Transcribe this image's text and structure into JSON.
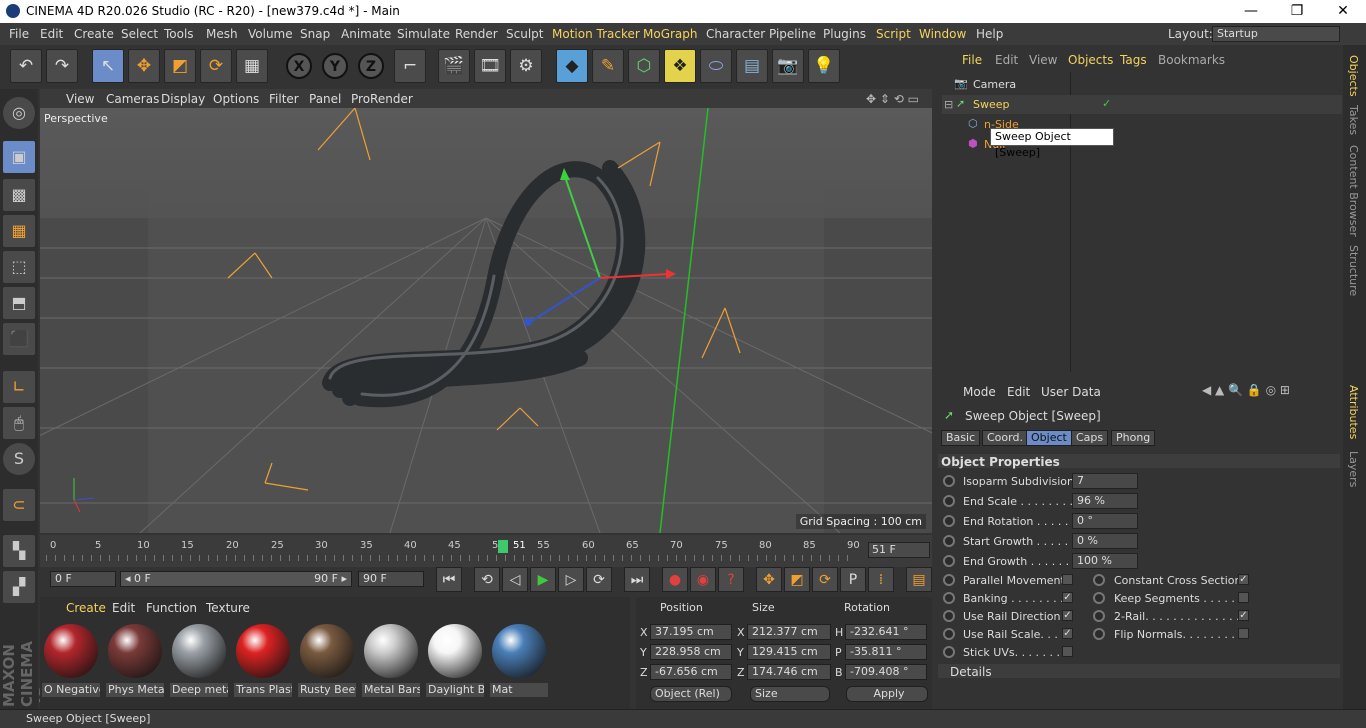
{
  "window": {
    "title": "CINEMA 4D R20.026 Studio (RC - R20) - [new379.c4d *] - Main",
    "minimize": "—",
    "maximize": "❐",
    "close": "✕"
  },
  "menu": {
    "items": [
      "File",
      "Edit",
      "Create",
      "Select",
      "Tools",
      "Mesh",
      "Volume",
      "Snap",
      "Animate",
      "Simulate",
      "Render",
      "Sculpt",
      "Motion Tracker",
      "MoGraph",
      "Character",
      "Pipeline",
      "Plugins",
      "Script",
      "Window",
      "Help"
    ],
    "layout_label": "Layout:",
    "layout_value": "Startup"
  },
  "viewport": {
    "menu": [
      "View",
      "Cameras",
      "Display",
      "Options",
      "Filter",
      "Panel",
      "ProRender"
    ],
    "camera": "Perspective",
    "grid_spacing": "Grid Spacing : 100 cm"
  },
  "timeline": {
    "ticks": [
      "0",
      "5",
      "10",
      "15",
      "20",
      "25",
      "30",
      "35",
      "40",
      "45",
      "50",
      "51",
      "55",
      "60",
      "65",
      "70",
      "75",
      "80",
      "85",
      "90"
    ],
    "current": "51 F"
  },
  "transport": {
    "start": "0 F",
    "range_start": "◂ 0 F",
    "range_end": "90 F ▸",
    "end": "90 F"
  },
  "materials": {
    "menu": [
      "Create",
      "Edit",
      "Function",
      "Texture"
    ],
    "items": [
      {
        "name": "O Negative",
        "color": "#b3262c"
      },
      {
        "name": "Phys Metal",
        "color": "#7a3a38"
      },
      {
        "name": "Deep metal",
        "color": "#9aa0a6"
      },
      {
        "name": "Trans Plasti",
        "color": "#dd2222"
      },
      {
        "name": "Rusty Beetl",
        "color": "#7a5a40"
      },
      {
        "name": "Metal Bars",
        "color": "#cccccc"
      },
      {
        "name": "Daylight Bu",
        "color": "#f6f6f6"
      },
      {
        "name": "Mat",
        "color": "#4a7fb8"
      }
    ]
  },
  "coords": {
    "headers": [
      "Position",
      "Size",
      "Rotation"
    ],
    "rows": [
      {
        "a": "X",
        "pos": "37.195 cm",
        "b": "X",
        "size": "212.377 cm",
        "c": "H",
        "rot": "-232.641 °"
      },
      {
        "a": "Y",
        "pos": "228.958 cm",
        "b": "Y",
        "size": "129.415 cm",
        "c": "P",
        "rot": "-35.811 °"
      },
      {
        "a": "Z",
        "pos": "-67.656 cm",
        "b": "Z",
        "size": "174.746 cm",
        "c": "B",
        "rot": "-709.408 °"
      }
    ],
    "mode": "Object (Rel)",
    "size_mode": "Size",
    "apply": "Apply"
  },
  "objects": {
    "menu": [
      "File",
      "Edit",
      "View",
      "Objects",
      "Tags",
      "Bookmarks"
    ],
    "rows": [
      {
        "name": "Camera"
      },
      {
        "name": "Sweep"
      },
      {
        "name": "n-Side"
      },
      {
        "name": "Null"
      }
    ],
    "tooltip": "Sweep Object [Sweep]"
  },
  "right_tabs": [
    "Objects",
    "Takes",
    "Content Browser",
    "Structure",
    "Attributes",
    "Layers"
  ],
  "attributes": {
    "menu": [
      "Mode",
      "Edit",
      "User Data"
    ],
    "title": "Sweep Object [Sweep]",
    "tabs": [
      "Basic",
      "Coord.",
      "Object",
      "Caps",
      "Phong"
    ],
    "section": "Object Properties",
    "props": [
      {
        "label": "Isoparm Subdivision",
        "value": "7"
      },
      {
        "label": "End Scale . . . . . . . . . .",
        "value": "96 %"
      },
      {
        "label": "End Rotation . . . . . .",
        "value": "0 °"
      },
      {
        "label": "Start Growth . . . . . .",
        "value": "0 %"
      },
      {
        "label": "End Growth . . . . . . .",
        "value": "100 %"
      }
    ],
    "checks_left": [
      {
        "label": "Parallel Movement",
        "checked": false
      },
      {
        "label": "Banking . . . . . . . . .",
        "checked": true
      },
      {
        "label": "Use Rail Direction",
        "checked": true
      },
      {
        "label": "Use Rail Scale. . . .",
        "checked": true
      },
      {
        "label": "Stick UVs. . . . . . . .",
        "checked": false
      }
    ],
    "checks_right": [
      {
        "label": "Constant Cross Section",
        "checked": true
      },
      {
        "label": "Keep Segments . . . . . .",
        "checked": false
      },
      {
        "label": "2-Rail. . . . . . . . . . . . . .",
        "checked": true
      },
      {
        "label": "Flip Normals. . . . . . . . .",
        "checked": false
      }
    ],
    "details": "Details"
  },
  "status": "Sweep Object [Sweep]",
  "brand": "MAXON CINEMA 4D"
}
